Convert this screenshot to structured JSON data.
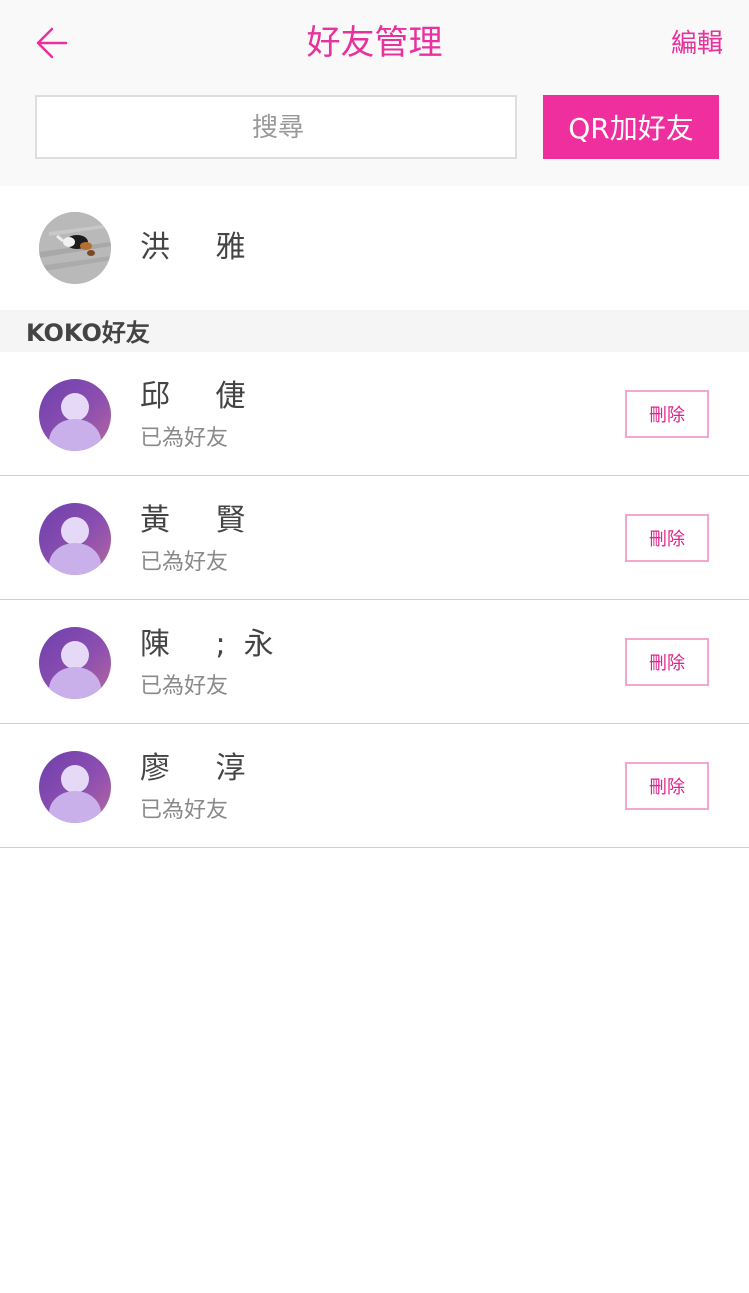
{
  "header": {
    "title": "好友管理",
    "edit_label": "編輯",
    "back_icon": "arrow-left-icon"
  },
  "search": {
    "placeholder": "搜尋",
    "value": ""
  },
  "qr_button_label": "QR加好友",
  "me": {
    "name": "洪 雅"
  },
  "section_title": "KOKO好友",
  "friends": [
    {
      "name": "邱 倢",
      "status": "已為好友",
      "delete_label": "刪除"
    },
    {
      "name": "黃 賢",
      "status": "已為好友",
      "delete_label": "刪除"
    },
    {
      "name": "陳 ;永",
      "status": "已為好友",
      "delete_label": "刪除"
    },
    {
      "name": "廖 淳",
      "status": "已為好友",
      "delete_label": "刪除"
    }
  ],
  "colors": {
    "accent": "#e8319c",
    "qr_button_bg": "#ef2f9d",
    "delete_border": "#f4a6d1"
  }
}
